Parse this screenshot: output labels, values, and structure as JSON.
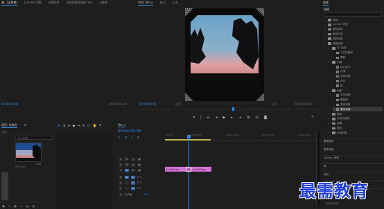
{
  "source_panel": {
    "tabs": [
      "源：(无剪辑)",
      "Lumetri 范围",
      "效果控件",
      "音频剪辑混合器: Ver",
      "元数据"
    ],
    "active_tab": 0,
    "timecode_left": "00:00:00:00",
    "timecode_right": "00:00:00:00"
  },
  "program_monitor": {
    "tabs": [
      "节目: Ver",
      "Ver",
      "标记",
      "文本",
      "(无剪辑)"
    ],
    "title": "节目: Ver ≡",
    "timecode": "00:00:05:06",
    "fit_label": "适合",
    "quality": "1/2",
    "duration": "00:00:10:00"
  },
  "project_panel": {
    "tabs": [
      "项目: 未命名",
      "库"
    ],
    "filename": "jpg",
    "search_hint": "(所以效果)",
    "thumb_label": "0002.jpg",
    "thumb_duration": "5:00"
  },
  "timeline": {
    "sequence_tab": "Ver ≡",
    "timecode": "00:00:05:06",
    "ruler_labels": [
      "00:00",
      "00:00:05:00",
      "00:00:10:00",
      "00:00:15:00",
      "00:00:20:00"
    ],
    "tracks": [
      {
        "id": "V3",
        "type": "video"
      },
      {
        "id": "V2",
        "type": "video"
      },
      {
        "id": "V1",
        "type": "video"
      },
      {
        "id": "A1",
        "type": "audio",
        "label": "M S"
      },
      {
        "id": "A2",
        "type": "audio",
        "label": "M S"
      },
      {
        "id": "A3",
        "type": "audio",
        "label": "M S"
      },
      {
        "id": "主声道",
        "type": "master",
        "value": "0.0"
      }
    ],
    "clips": [
      {
        "label": "fx  0002.jpg"
      },
      {
        "label": "fx  0002.jpg"
      }
    ]
  },
  "effects_panel": {
    "tabs": [
      "效果",
      "效果"
    ],
    "items": [
      {
        "label": "预设",
        "indent": 0,
        "kind": "folder"
      },
      {
        "label": "Lumetri 预设",
        "indent": 0,
        "kind": "folder"
      },
      {
        "label": "音频效果",
        "indent": 0,
        "kind": "folder"
      },
      {
        "label": "音频过渡",
        "indent": 0,
        "kind": "folder"
      },
      {
        "label": "视频效果",
        "indent": 0,
        "kind": "folder"
      },
      {
        "label": "视频过渡",
        "indent": 0,
        "kind": "folder"
      },
      {
        "label": "3D 运动",
        "indent": 1,
        "kind": "folder"
      },
      {
        "label": "立方体旋转",
        "indent": 2,
        "kind": "clip"
      },
      {
        "label": "翻转",
        "indent": 2,
        "kind": "clip"
      },
      {
        "label": "内滑",
        "indent": 1,
        "kind": "folder"
      },
      {
        "label": "中心拆分",
        "indent": 2,
        "kind": "clip"
      },
      {
        "label": "内滑",
        "indent": 2,
        "kind": "clip"
      },
      {
        "label": "带状内滑",
        "indent": 2,
        "kind": "clip"
      },
      {
        "label": "拆分",
        "indent": 2,
        "kind": "clip"
      },
      {
        "label": "推",
        "indent": 2,
        "kind": "clip"
      },
      {
        "label": "划像",
        "indent": 1,
        "kind": "folder"
      },
      {
        "label": "交叉划像",
        "indent": 2,
        "kind": "clip"
      },
      {
        "label": "圆划像",
        "indent": 2,
        "kind": "clip"
      },
      {
        "label": "盒形划像",
        "indent": 2,
        "kind": "clip"
      },
      {
        "label": "菱形划像",
        "indent": 2,
        "kind": "clip",
        "selected": true
      },
      {
        "label": "擦除",
        "indent": 1,
        "kind": "folder"
      },
      {
        "label": "沉浸式视频",
        "indent": 1,
        "kind": "folder"
      },
      {
        "label": "溶解",
        "indent": 1,
        "kind": "folder"
      },
      {
        "label": "缩放",
        "indent": 1,
        "kind": "folder"
      },
      {
        "label": "页面剥落",
        "indent": 1,
        "kind": "folder"
      }
    ],
    "sections": [
      "基本图形",
      "基本声音",
      "Lumetri 颜色",
      "库",
      "标记",
      "历史记录",
      "信息"
    ],
    "bottom_label": "运动标准版"
  },
  "watermark": "最需教育"
}
